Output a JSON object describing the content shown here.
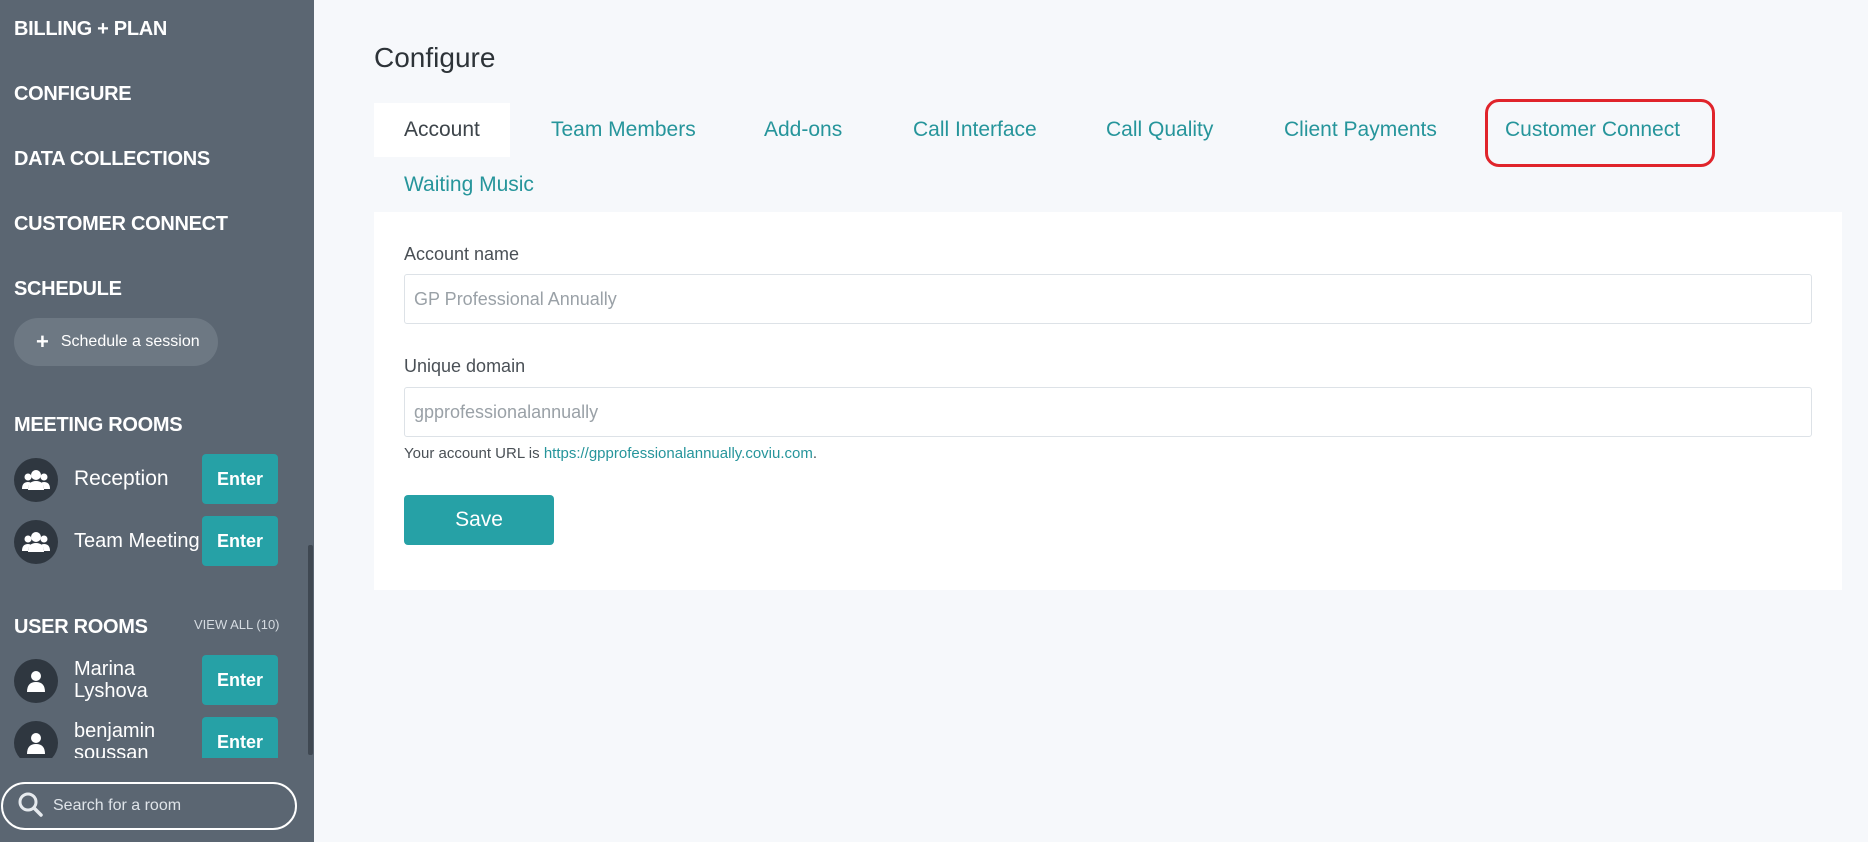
{
  "sidebar": {
    "headings": {
      "billing": "BILLING + PLAN",
      "configure": "CONFIGURE",
      "data_collections": "DATA COLLECTIONS",
      "customer_connect": "CUSTOMER CONNECT",
      "schedule": "SCHEDULE",
      "meeting_rooms": "MEETING ROOMS",
      "user_rooms": "USER ROOMS"
    },
    "schedule_button": {
      "icon": "plus-icon",
      "label": "Schedule a session"
    },
    "meeting_rooms": [
      {
        "name": "Reception",
        "icon": "group-icon",
        "action": "Enter"
      },
      {
        "name": "Team Meeting",
        "icon": "group-icon",
        "action": "Enter"
      }
    ],
    "view_all": "VIEW ALL (10)",
    "user_rooms": [
      {
        "name": "Marina Lyshova",
        "icon": "user-icon",
        "action": "Enter"
      },
      {
        "name": "benjamin soussan",
        "icon": "user-icon",
        "action": "Enter"
      }
    ],
    "search": {
      "icon": "search-icon",
      "placeholder": "Search for a room",
      "value": ""
    }
  },
  "main": {
    "title": "Configure",
    "tabs": [
      {
        "label": "Account",
        "active": true
      },
      {
        "label": "Team Members",
        "active": false
      },
      {
        "label": "Add-ons",
        "active": false
      },
      {
        "label": "Call Interface",
        "active": false
      },
      {
        "label": "Call Quality",
        "active": false
      },
      {
        "label": "Client Payments",
        "active": false
      },
      {
        "label": "Customer Connect",
        "active": false,
        "highlighted": true
      },
      {
        "label": "Waiting Music",
        "active": false
      }
    ],
    "form": {
      "account_name_label": "Account name",
      "account_name_value": "GP Professional Annually",
      "domain_label": "Unique domain",
      "domain_value": "gpprofessionalannually",
      "url_prefix": "Your account URL is ",
      "url_link": "https://gpprofessionalannually.coviu.com",
      "url_suffix": ".",
      "save_label": "Save"
    }
  },
  "colors": {
    "sidebar_bg": "#5b6672",
    "accent": "#26a1a6",
    "link": "#26959b",
    "highlight_outline": "#e0242b",
    "page_bg": "#f6f8fb"
  }
}
